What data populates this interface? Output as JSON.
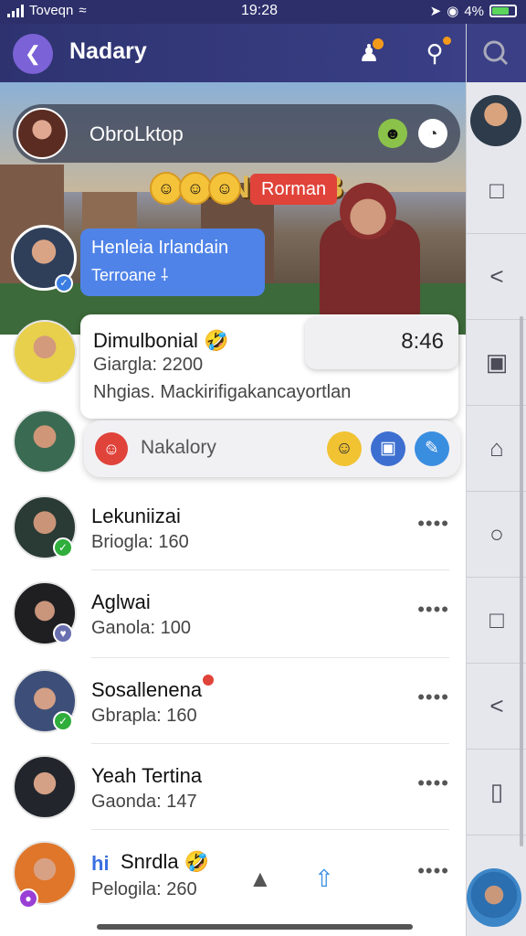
{
  "status_bar": {
    "carrier": "Toveqn",
    "time": "19:28",
    "battery": "4%"
  },
  "header": {
    "title": "Nadary",
    "back_icon": "back-arrow-icon",
    "people_icon": "people-icon",
    "search_icon": "search-icon"
  },
  "banner": {
    "title": "SANNNAB",
    "group_name": "ObroLktop",
    "tag": "Rorman"
  },
  "story": {
    "line1": "Henleia Irlandain",
    "line2": "Terroane ⸸"
  },
  "card": {
    "name": "Dimulbonial 🤣",
    "line1": "Giargla: 2200",
    "line2": "Nhgias. Mackirifigakancayortlan",
    "time": "8:46"
  },
  "reply": {
    "text": "Nakalory"
  },
  "chats": [
    {
      "name": "Lekuniizai",
      "sub": "Briogla: 160"
    },
    {
      "name": "Aglwai",
      "sub": "Ganola: 100"
    },
    {
      "name": "Sosallenena",
      "sub": "Gbrapla: 160"
    },
    {
      "name": "Yeah Tertina",
      "sub": "Gaonda: 147"
    },
    {
      "name": "Snrdla 🤣",
      "sub": "Pelogila: 260"
    }
  ],
  "chat_name_prefix": "hi",
  "more_label": "••••",
  "colors": {
    "header": "#2e3370",
    "accent": "#7b62d6",
    "bubble": "#4f83e8",
    "verified": "#2fae3c"
  }
}
